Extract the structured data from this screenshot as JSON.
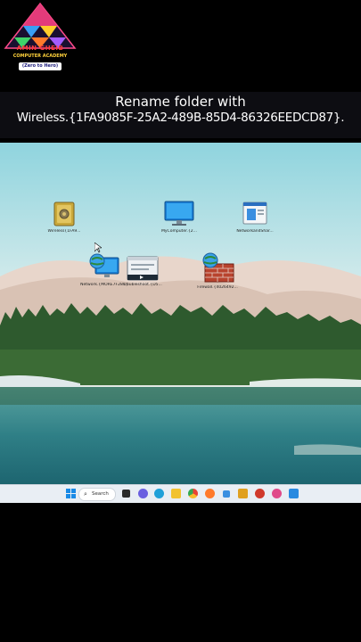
{
  "channel": {
    "name": "AMIN GHEIB",
    "subtitle": "COMPUTER ACADEMY",
    "tagline": "(Zero to Hero)"
  },
  "caption": {
    "line1": "Rename folder with",
    "line2": "Wireless.{1FA9085F-25A2-489B-85D4-86326EEDCD87}."
  },
  "desktop": {
    "icons": [
      {
        "name": "safe-icon",
        "label": "Wireless{1FA9..."
      },
      {
        "name": "monitor-icon",
        "label": "MyComputer.{2..."
      },
      {
        "name": "window-doc-icon",
        "label": "NetworkandShar..."
      },
      {
        "name": "network-globe-icon",
        "label": "Network.{MORE7F28C}"
      },
      {
        "name": "media-player-icon",
        "label": "Troubleshoot.{D5..."
      },
      {
        "name": "firewall-icon",
        "label": "Firewall.{4026492..."
      }
    ]
  },
  "taskbar": {
    "search_label": "Search",
    "apps": [
      "start",
      "search",
      "task-view",
      "chat",
      "edge",
      "files",
      "chrome",
      "firefox",
      "mail",
      "store",
      "photos",
      "media",
      "terminal",
      "settings"
    ]
  }
}
